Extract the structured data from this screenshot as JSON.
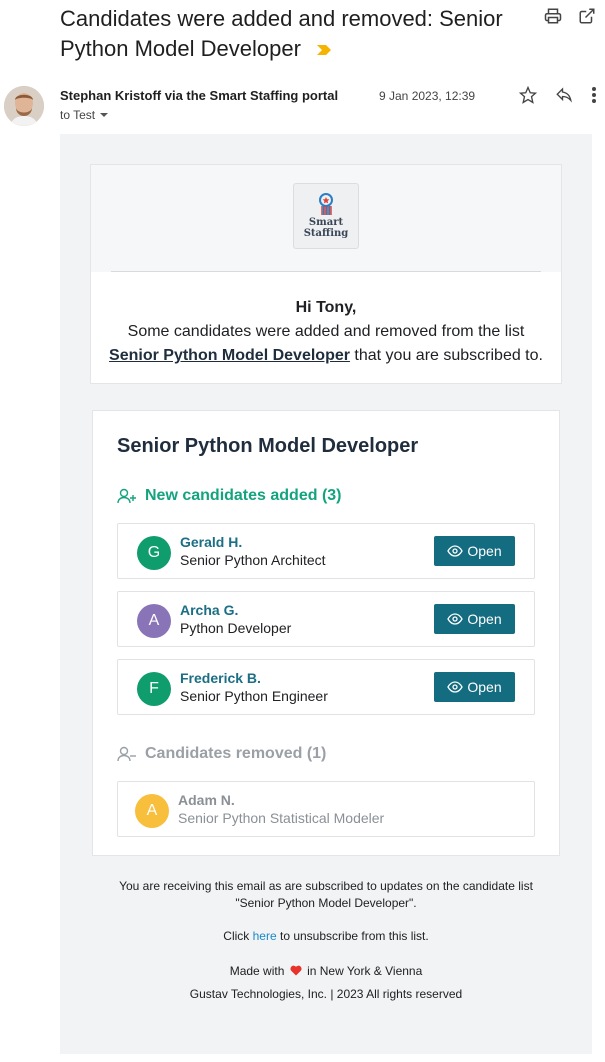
{
  "subject": "Candidates were added and removed: Senior Python Model Developer",
  "sender": "Stephan Kristoff via the Smart Staffing portal",
  "date": "9 Jan 2023, 12:39",
  "recipient": "to Test",
  "logo": {
    "line1": "Smart",
    "line2": "Staffing"
  },
  "greeting": {
    "hi": "Hi Tony,",
    "line1": "Some candidates were added and removed from the list",
    "list_link": "Senior Python Model Developer",
    "line2_suffix": " that you are subscribed to."
  },
  "list_title": "Senior Python Model Developer",
  "added_heading": "New candidates added (3)",
  "removed_heading": "Candidates removed (1)",
  "open_label": "Open",
  "added": [
    {
      "initial": "G",
      "name": "Gerald H.",
      "role": "Senior Python Architect",
      "color": "#0f9d6e"
    },
    {
      "initial": "A",
      "name": "Archa G.",
      "role": "Python Developer",
      "color": "#8a74b8"
    },
    {
      "initial": "F",
      "name": "Frederick B.",
      "role": "Senior Python Engineer",
      "color": "#0f9d6e"
    }
  ],
  "removed": [
    {
      "initial": "A",
      "name": "Adam N.",
      "role": "Senior Python Statistical Modeler",
      "color": "#f7bf3c"
    }
  ],
  "footer": {
    "notice1": "You are receiving this email as are subscribed to updates on the candidate list",
    "notice2": "\"Senior Python Model Developer\".",
    "click": "Click ",
    "here": "here",
    "unsub": " to unsubscribe from this list.",
    "made_with": "Made with",
    "made_in": "in New York & Vienna",
    "copyright": "Gustav Technologies, Inc. | 2023 All rights reserved"
  }
}
